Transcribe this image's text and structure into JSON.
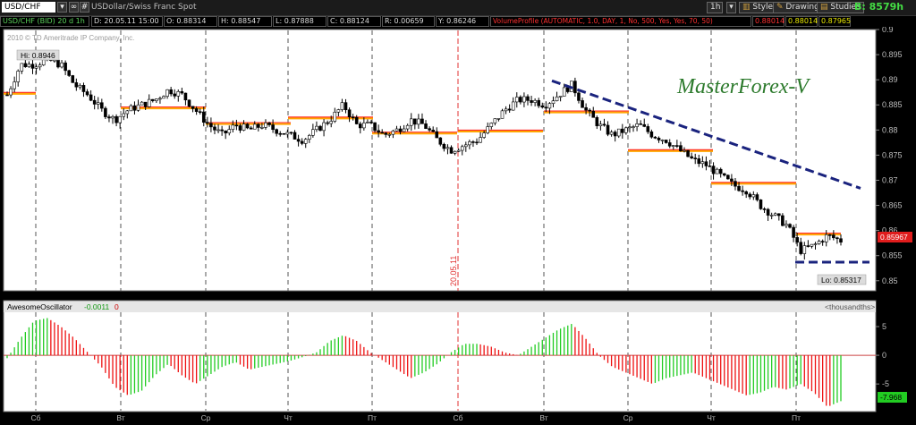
{
  "toolbar": {
    "symbol": "USD/CHF",
    "symbol_icon": "dropdown-arrow",
    "link_icon": "chain-link",
    "hash_label": "#",
    "description": "USDollar/Swiss Franc Spot",
    "timeframe": "1h",
    "style": "Style",
    "drawings": "Drawings",
    "studies": "Studies",
    "balance_label": "B:",
    "balance_value": "8579h"
  },
  "info": {
    "symbol_period": "USD/CHF (BID) 20 d 1h",
    "date": "D: 20.05.11 15:00",
    "open": "O: 0.88314",
    "high": "H: 0.88547",
    "low": "L: 0.87888",
    "close": "C: 0.88124",
    "range": "R: 0.00659",
    "y": "Y: 0.86246",
    "volume_profile": "VolumeProfile (AUTOMATIC, 1.0, DAY, 1, No, 500, Yes, Yes, 70, 50)",
    "vp1": "0.88014",
    "vp2": "0.88014",
    "vp3": "0.87965"
  },
  "chart_data": {
    "type": "candlestick",
    "copyright": "2010 © TD Ameritrade IP Company, Inc.",
    "watermark": "MasterForex-V",
    "hi_label": "Hi: 0.8946",
    "lo_label": "Lo: 0.85317",
    "current_price_label": "0.85967",
    "marker_date": "20.05.11",
    "ylim": [
      0.848,
      0.9
    ],
    "y_ticks": [
      "0.9",
      "0.895",
      "0.89",
      "0.885",
      "0.88",
      "0.875",
      "0.87",
      "0.865",
      "0.86",
      "0.855",
      "0.85"
    ],
    "x_tick_labels": [
      "Сб",
      "Вт",
      "Ср",
      "Чт",
      "Пт",
      "Сб",
      "Вт",
      "Ср",
      "Чт",
      "Пт"
    ],
    "close_path": [
      0.887,
      0.893,
      0.893,
      0.894,
      0.893,
      0.889,
      0.887,
      0.884,
      0.882,
      0.884,
      0.885,
      0.886,
      0.888,
      0.887,
      0.884,
      0.881,
      0.879,
      0.881,
      0.88,
      0.881,
      0.88,
      0.879,
      0.878,
      0.88,
      0.882,
      0.885,
      0.881,
      0.881,
      0.879,
      0.88,
      0.882,
      0.881,
      0.878,
      0.876,
      0.877,
      0.878,
      0.881,
      0.884,
      0.886,
      0.886,
      0.885,
      0.887,
      0.889,
      0.884,
      0.881,
      0.879,
      0.88,
      0.881,
      0.879,
      0.878,
      0.876,
      0.874,
      0.873,
      0.871,
      0.869,
      0.868,
      0.865,
      0.863,
      0.861,
      0.856,
      0.857,
      0.859,
      0.858
    ],
    "volume_profile_levels": [
      {
        "day": "Сб",
        "value": 0.8872
      },
      {
        "day": "Вт",
        "value": 0.8843
      },
      {
        "day": "Ср",
        "value": 0.8812
      },
      {
        "day": "Чт",
        "value": 0.8823
      },
      {
        "day": "Пт",
        "value": 0.8793
      },
      {
        "day": "Сб",
        "value": 0.8797
      },
      {
        "day": "Вт",
        "value": 0.8835
      },
      {
        "day": "Ср",
        "value": 0.8758
      },
      {
        "day": "Чт",
        "value": 0.8693
      },
      {
        "day": "Пт",
        "value": 0.8592
      }
    ],
    "trendlines": [
      {
        "name": "resistance",
        "from": 0.8898,
        "to": 0.8684
      },
      {
        "name": "support",
        "value": 0.8537
      }
    ],
    "oscillator": {
      "name": "AwesomeOscillator",
      "value": "-0.0011",
      "param": "0",
      "units": "<thousandths>",
      "last_label": "-7.968",
      "y_ticks": [
        "5",
        "0",
        "-5"
      ],
      "ylim": [
        -9.5,
        7.5
      ],
      "path": [
        -0.5,
        3,
        6,
        6.5,
        5,
        3,
        0.5,
        -2,
        -5.5,
        -7,
        -6.2,
        -3.5,
        -1.5,
        -3.5,
        -5,
        -3.5,
        -2,
        -1.2,
        -2.5,
        -2,
        -1.5,
        -1,
        -0.3,
        0.5,
        2.5,
        3.5,
        2.5,
        0.5,
        -1,
        -2.5,
        -4,
        -3,
        -1.5,
        0.5,
        2,
        2,
        1.5,
        0.5,
        0,
        1.5,
        3,
        4.5,
        5.5,
        3,
        0,
        -2,
        -3,
        -4,
        -5,
        -4,
        -3.5,
        -3,
        -4,
        -5,
        -6,
        -7,
        -6.5,
        -5.5,
        -6,
        -5,
        -6.5,
        -9,
        -8
      ]
    }
  }
}
